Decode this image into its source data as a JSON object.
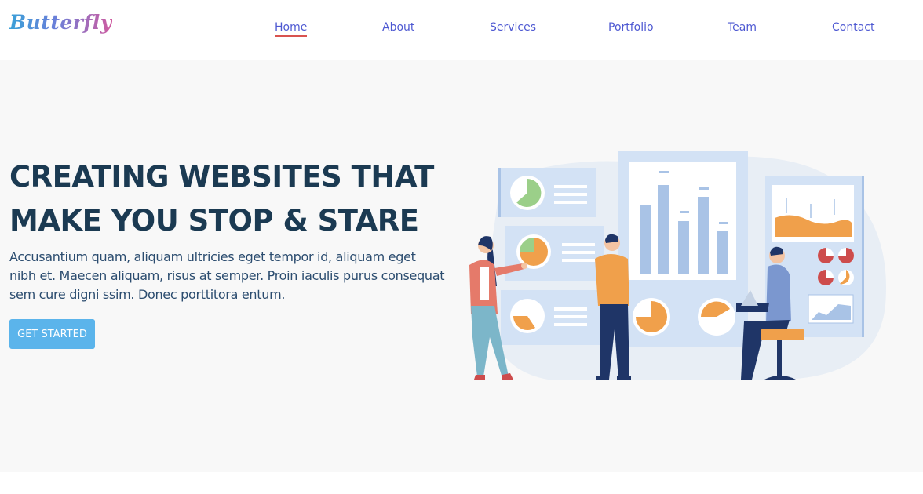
{
  "brand": {
    "name": "Butterfly"
  },
  "nav": {
    "items": [
      {
        "label": "Home",
        "active": true
      },
      {
        "label": "About"
      },
      {
        "label": "Services"
      },
      {
        "label": "Portfolio"
      },
      {
        "label": "Team"
      },
      {
        "label": "Contact"
      }
    ]
  },
  "hero": {
    "title_line1": "CREATING WEBSITES THAT",
    "title_line2": "MAKE YOU STOP & STARE",
    "text": "Accusantium quam, aliquam ultricies eget tempor id, aliquam eget nibh et. Maecen aliquam, risus at semper. Proin iaculis purus consequat sem cure digni ssim. Donec porttitora entum.",
    "cta_label": "GET STARTED"
  },
  "colors": {
    "accent": "#5bb4eb",
    "nav_link": "#4e59d2",
    "active_underline": "#d9534f",
    "heading": "#1b3a52"
  }
}
